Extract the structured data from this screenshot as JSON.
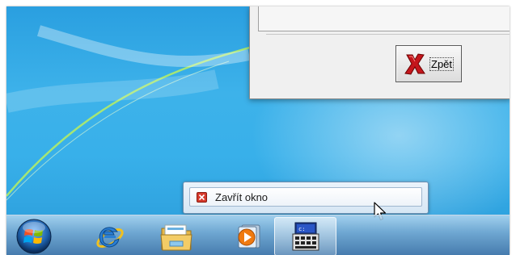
{
  "dialog": {
    "back_button_label": "Zpět"
  },
  "jumplist": {
    "close_window_label": "Zavřít okno"
  },
  "taskbar": {
    "items": [
      {
        "icon": "windows-start-icon"
      },
      {
        "icon": "internet-explorer-icon"
      },
      {
        "icon": "file-explorer-icon"
      },
      {
        "icon": "media-player-icon"
      },
      {
        "icon": "console-app-icon",
        "active": true
      }
    ]
  },
  "colors": {
    "desktop_blue": "#3db2ea",
    "swoosh_green": "#9ee84a",
    "close_red": "#d63a2c"
  }
}
